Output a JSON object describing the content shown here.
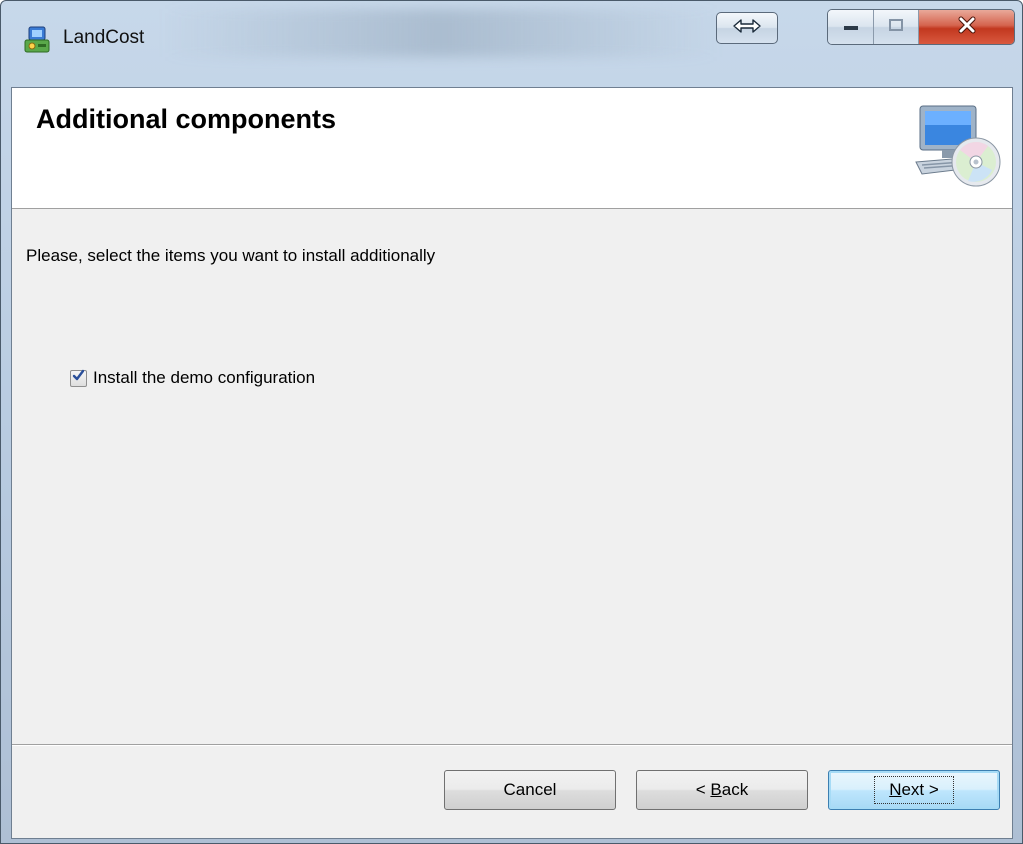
{
  "window": {
    "title": "LandCost",
    "icons": {
      "app": "installer-app-icon",
      "resize": "resize-arrows-icon",
      "minimize": "minimize-icon",
      "maximize": "maximize-icon",
      "close": "close-icon",
      "banner": "computer-with-cd-icon"
    }
  },
  "banner": {
    "title": "Additional components"
  },
  "body": {
    "prompt": "Please, select the items you want to install additionally",
    "options": [
      {
        "label": "Install the demo configuration",
        "checked": true
      }
    ]
  },
  "buttons": {
    "cancel": "Cancel",
    "back_prefix": "< ",
    "back_mnemonic": "B",
    "back_rest": "ack",
    "next_mnemonic": "N",
    "next_rest": "ext >"
  },
  "colors": {
    "close_button": "#c2381f",
    "default_button_border": "#3c7fb1",
    "client_background": "#f0f0f0"
  }
}
